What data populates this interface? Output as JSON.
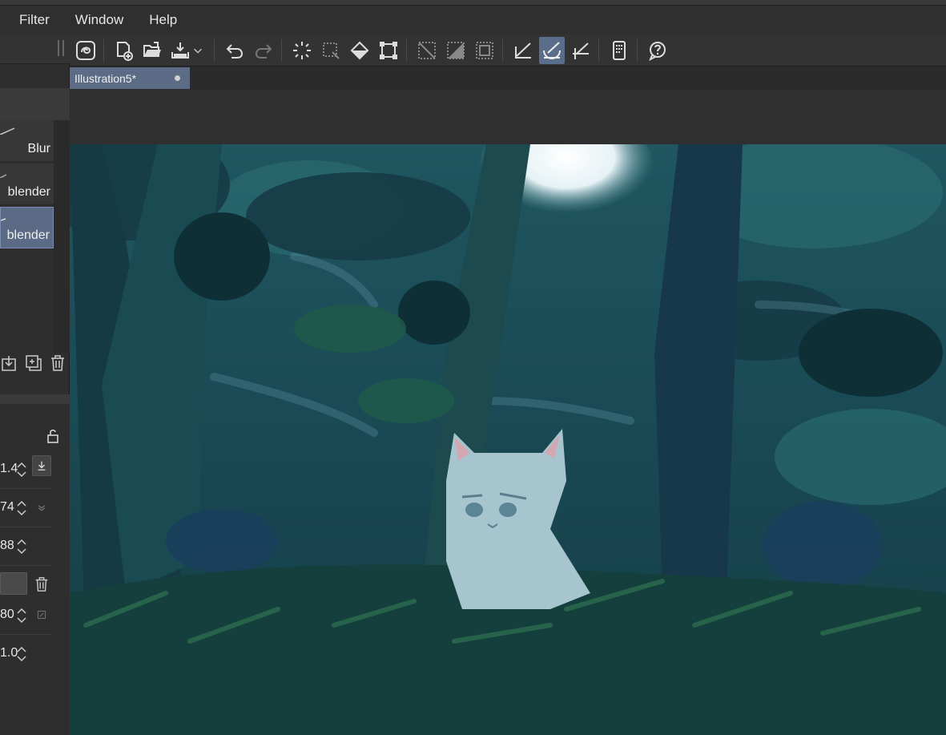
{
  "menubar": {
    "items": [
      {
        "label": "Filter"
      },
      {
        "label": "Window"
      },
      {
        "label": "Help"
      }
    ]
  },
  "document": {
    "tab_title": "Illustration5*"
  },
  "brushes": [
    {
      "label": "Blur",
      "selected": false
    },
    {
      "label": "blender",
      "selected": false
    },
    {
      "label": "blender",
      "selected": true
    }
  ],
  "properties": [
    {
      "value": "1.4"
    },
    {
      "value": "74"
    },
    {
      "value": "88"
    },
    {
      "value": "80"
    },
    {
      "value": "1.0"
    }
  ],
  "toolbar": {
    "icons": [
      "app-logo-icon",
      "new-file-icon",
      "open-folder-icon",
      "save-icon",
      "dropdown-chevron-icon",
      "undo-icon",
      "redo-icon",
      "clear-selection-icon",
      "select-all-icon",
      "fill-icon",
      "transform-icon",
      "hide-selection-icon",
      "invert-selection-icon",
      "selection-border-icon",
      "ruler-snap-icon",
      "special-ruler-snap-icon",
      "grid-snap-icon",
      "companion-mode-icon",
      "help-icon"
    ],
    "active_icon": "special-ruler-snap-icon"
  },
  "colors": {
    "accent": "#5c6b86",
    "selected_row": "#5b6a85",
    "panel": "#2e2e2e"
  }
}
